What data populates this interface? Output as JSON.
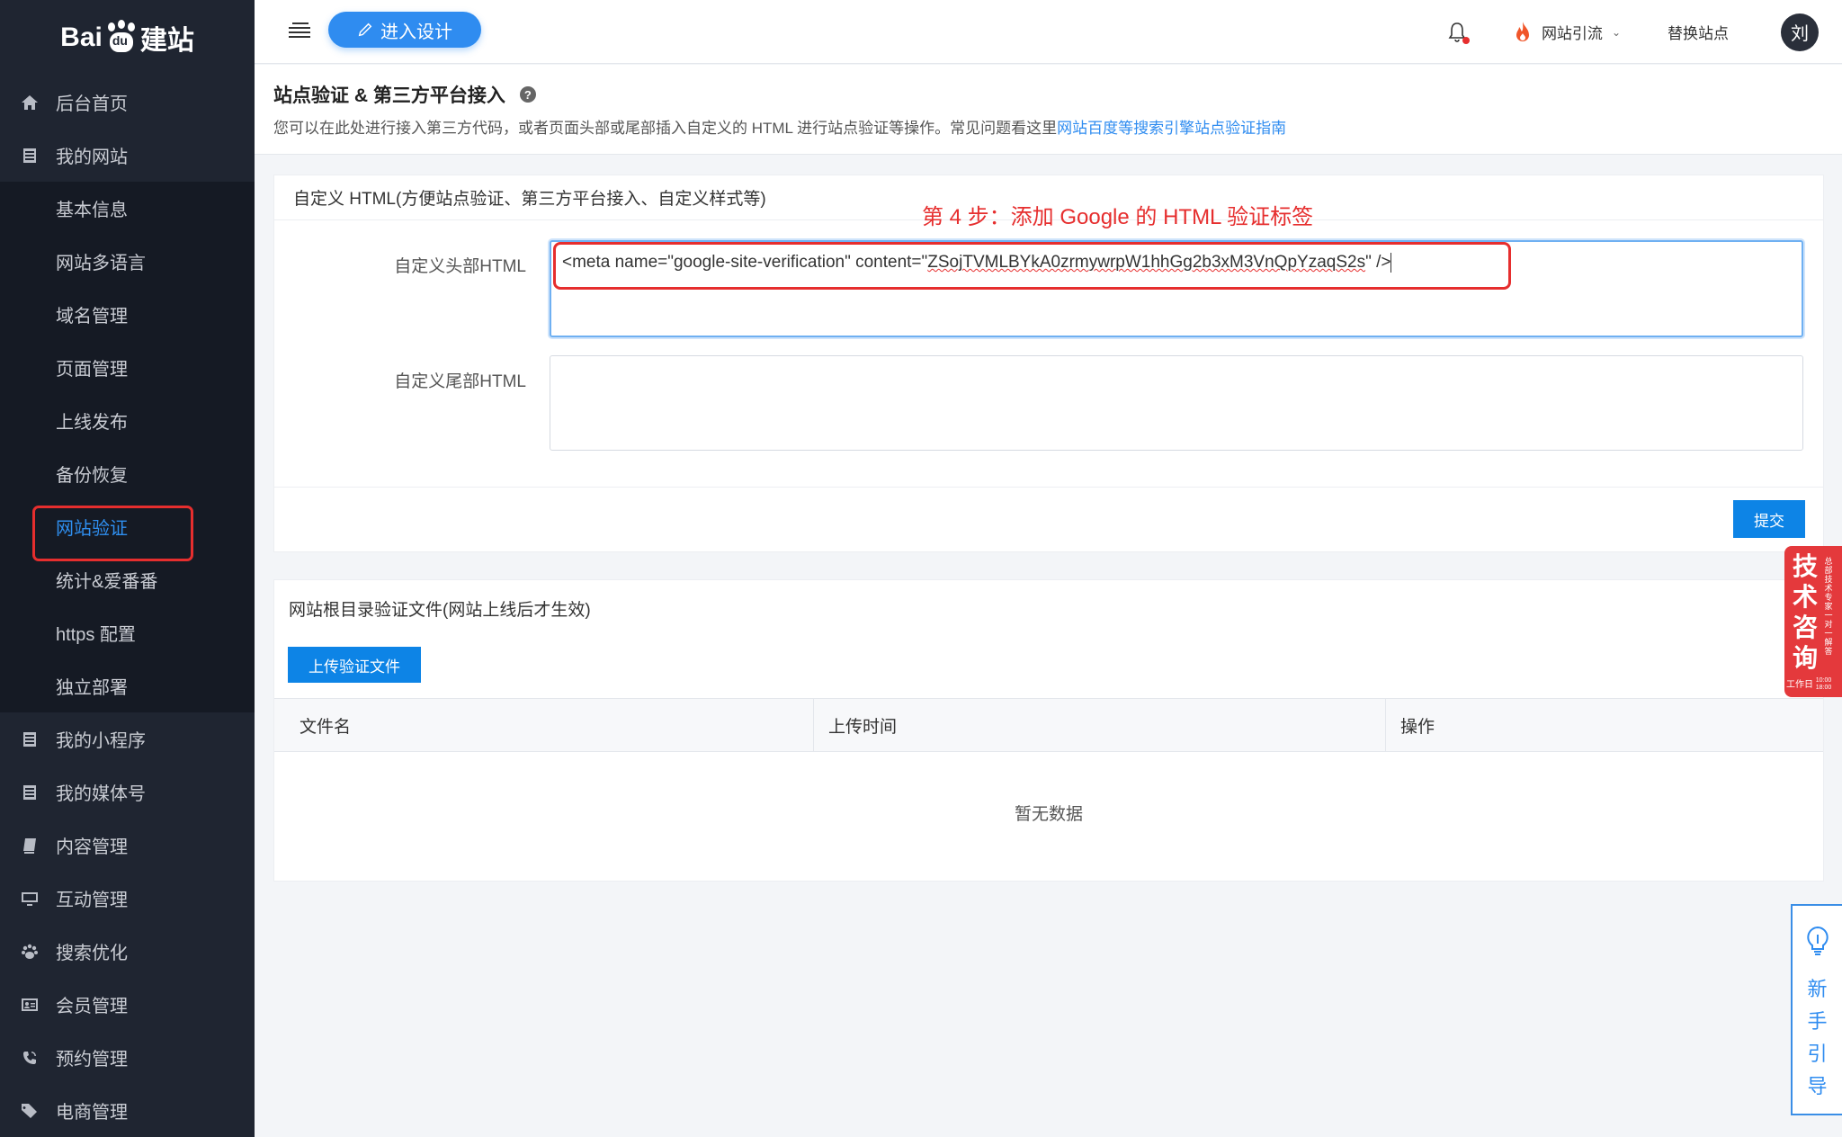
{
  "sidebar": {
    "logo": {
      "left": "Bai",
      "paw": "du",
      "right": "建站"
    },
    "items": [
      {
        "label": "后台首页",
        "icon": "home-icon"
      },
      {
        "label": "我的网站",
        "icon": "list-icon"
      }
    ],
    "sub_items": [
      {
        "label": "基本信息"
      },
      {
        "label": "网站多语言"
      },
      {
        "label": "域名管理"
      },
      {
        "label": "页面管理"
      },
      {
        "label": "上线发布"
      },
      {
        "label": "备份恢复"
      },
      {
        "label": "网站验证",
        "active": true
      },
      {
        "label": "统计&爱番番"
      },
      {
        "label": "https 配置"
      },
      {
        "label": "独立部署"
      }
    ],
    "items_after": [
      {
        "label": "我的小程序",
        "icon": "list-icon"
      },
      {
        "label": "我的媒体号",
        "icon": "list-icon"
      },
      {
        "label": "内容管理",
        "icon": "book-icon"
      },
      {
        "label": "互动管理",
        "icon": "monitor-icon"
      },
      {
        "label": "搜索优化",
        "icon": "paw-icon"
      },
      {
        "label": "会员管理",
        "icon": "id-card-icon"
      },
      {
        "label": "预约管理",
        "icon": "phone-icon"
      },
      {
        "label": "电商管理",
        "icon": "tags-icon"
      }
    ]
  },
  "header": {
    "design_button": "进入设计",
    "traffic_label": "网站引流",
    "switch_site": "替换站点",
    "avatar": "刘"
  },
  "page": {
    "title": "站点验证 & 第三方平台接入",
    "help_icon": "?",
    "desc": "您可以在此处进行接入第三方代码，或者页面头部或尾部插入自定义的 HTML 进行站点验证等操作。常见问题看这里",
    "desc_link": "网站百度等搜索引擎站点验证指南"
  },
  "custom_html": {
    "title": "自定义 HTML(方便站点验证、第三方平台接入、自定义样式等)",
    "annotation": "第 4 步：添加 Google 的 HTML 验证标签",
    "head_label": "自定义头部HTML",
    "head_value_prefix": "<meta name=\"google-site-verification\" content=\"",
    "head_value_token": "ZSojTVMLBYkA0zrmywrpW1hhGg2b3xM3VnQpYzaqS2s",
    "head_value_suffix": "\" />",
    "foot_label": "自定义尾部HTML",
    "foot_value": "",
    "submit": "提交"
  },
  "verify_files": {
    "title": "网站根目录验证文件(网站上线后才生效)",
    "upload_button": "上传验证文件",
    "columns": [
      "文件名",
      "上传时间",
      "操作"
    ],
    "empty_text": "暂无数据"
  },
  "float_tech": {
    "big": [
      "技",
      "术",
      "咨",
      "询"
    ],
    "small": "总部技术专家一对一解答",
    "foot": "工作日",
    "hours": "10:00\n18:00"
  },
  "float_guide": {
    "label": "新手引导"
  },
  "colors": {
    "sidebar_bg": "#1f2531",
    "accent": "#2f8cf0",
    "annotation_red": "#e62e2e",
    "primary_button": "#0d84e6"
  }
}
